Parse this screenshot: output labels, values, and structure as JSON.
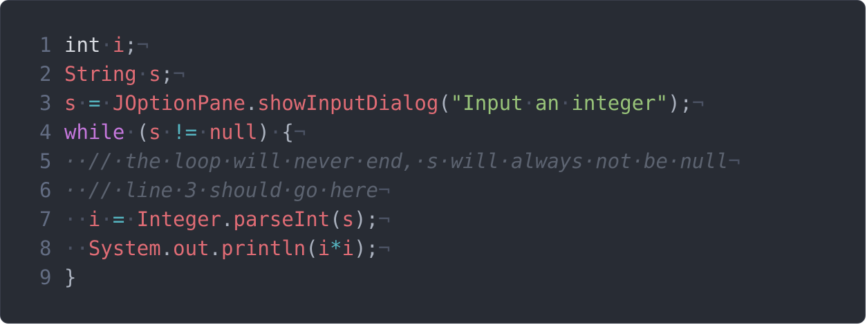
{
  "editor": {
    "background": "#282c34",
    "colors": {
      "identifier": "#e06c75",
      "keyword": "#c678dd",
      "string": "#98c379",
      "operator": "#56b6c2",
      "comment": "#5c6370",
      "line_number": "#636d83",
      "whitespace_marker": "#4b5263"
    },
    "lines": [
      {
        "number": "1",
        "tokens": [
          {
            "t": "int",
            "c": "plain"
          },
          {
            "t": "·",
            "c": "ws"
          },
          {
            "t": "i",
            "c": "ident"
          },
          {
            "t": ";",
            "c": "punc"
          },
          {
            "t": "¬",
            "c": "eol"
          }
        ]
      },
      {
        "number": "2",
        "tokens": [
          {
            "t": "String",
            "c": "ident"
          },
          {
            "t": "·",
            "c": "ws"
          },
          {
            "t": "s",
            "c": "ident"
          },
          {
            "t": ";",
            "c": "punc"
          },
          {
            "t": "¬",
            "c": "eol"
          }
        ]
      },
      {
        "number": "3",
        "tokens": [
          {
            "t": "s",
            "c": "ident"
          },
          {
            "t": "·",
            "c": "ws"
          },
          {
            "t": "=",
            "c": "op"
          },
          {
            "t": "·",
            "c": "ws"
          },
          {
            "t": "JOptionPane",
            "c": "ident"
          },
          {
            "t": ".",
            "c": "punc"
          },
          {
            "t": "showInputDialog",
            "c": "ident"
          },
          {
            "t": "(",
            "c": "punc"
          },
          {
            "t": "\"Input",
            "c": "str"
          },
          {
            "t": "·",
            "c": "ws"
          },
          {
            "t": "an",
            "c": "str"
          },
          {
            "t": "·",
            "c": "ws"
          },
          {
            "t": "integer\"",
            "c": "str"
          },
          {
            "t": ");",
            "c": "punc"
          },
          {
            "t": "¬",
            "c": "eol"
          }
        ]
      },
      {
        "number": "4",
        "tokens": [
          {
            "t": "while",
            "c": "kw"
          },
          {
            "t": "·",
            "c": "ws"
          },
          {
            "t": "(",
            "c": "punc"
          },
          {
            "t": "s",
            "c": "ident"
          },
          {
            "t": "·",
            "c": "ws"
          },
          {
            "t": "!=",
            "c": "op"
          },
          {
            "t": "·",
            "c": "ws"
          },
          {
            "t": "null",
            "c": "ident"
          },
          {
            "t": ")",
            "c": "punc"
          },
          {
            "t": "·",
            "c": "ws"
          },
          {
            "t": "{",
            "c": "punc"
          },
          {
            "t": "¬",
            "c": "eol"
          }
        ]
      },
      {
        "number": "5",
        "tokens": [
          {
            "t": "··//·the·loop·will·never·end,·s·will·always·not·be·null",
            "c": "comment"
          },
          {
            "t": "¬",
            "c": "eol"
          }
        ]
      },
      {
        "number": "6",
        "tokens": [
          {
            "t": "··//·line·3·should·go·here",
            "c": "comment"
          },
          {
            "t": "¬",
            "c": "eol"
          }
        ]
      },
      {
        "number": "7",
        "tokens": [
          {
            "t": "··",
            "c": "ws"
          },
          {
            "t": "i",
            "c": "ident"
          },
          {
            "t": "·",
            "c": "ws"
          },
          {
            "t": "=",
            "c": "op"
          },
          {
            "t": "·",
            "c": "ws"
          },
          {
            "t": "Integer",
            "c": "ident"
          },
          {
            "t": ".",
            "c": "punc"
          },
          {
            "t": "parseInt",
            "c": "ident"
          },
          {
            "t": "(",
            "c": "punc"
          },
          {
            "t": "s",
            "c": "ident"
          },
          {
            "t": ");",
            "c": "punc"
          },
          {
            "t": "¬",
            "c": "eol"
          }
        ]
      },
      {
        "number": "8",
        "tokens": [
          {
            "t": "··",
            "c": "ws"
          },
          {
            "t": "System",
            "c": "ident"
          },
          {
            "t": ".",
            "c": "punc"
          },
          {
            "t": "out",
            "c": "ident"
          },
          {
            "t": ".",
            "c": "punc"
          },
          {
            "t": "println",
            "c": "ident"
          },
          {
            "t": "(",
            "c": "punc"
          },
          {
            "t": "i",
            "c": "ident"
          },
          {
            "t": "*",
            "c": "op"
          },
          {
            "t": "i",
            "c": "ident"
          },
          {
            "t": ");",
            "c": "punc"
          },
          {
            "t": "¬",
            "c": "eol"
          }
        ]
      },
      {
        "number": "9",
        "tokens": [
          {
            "t": "}",
            "c": "punc"
          }
        ]
      }
    ]
  }
}
